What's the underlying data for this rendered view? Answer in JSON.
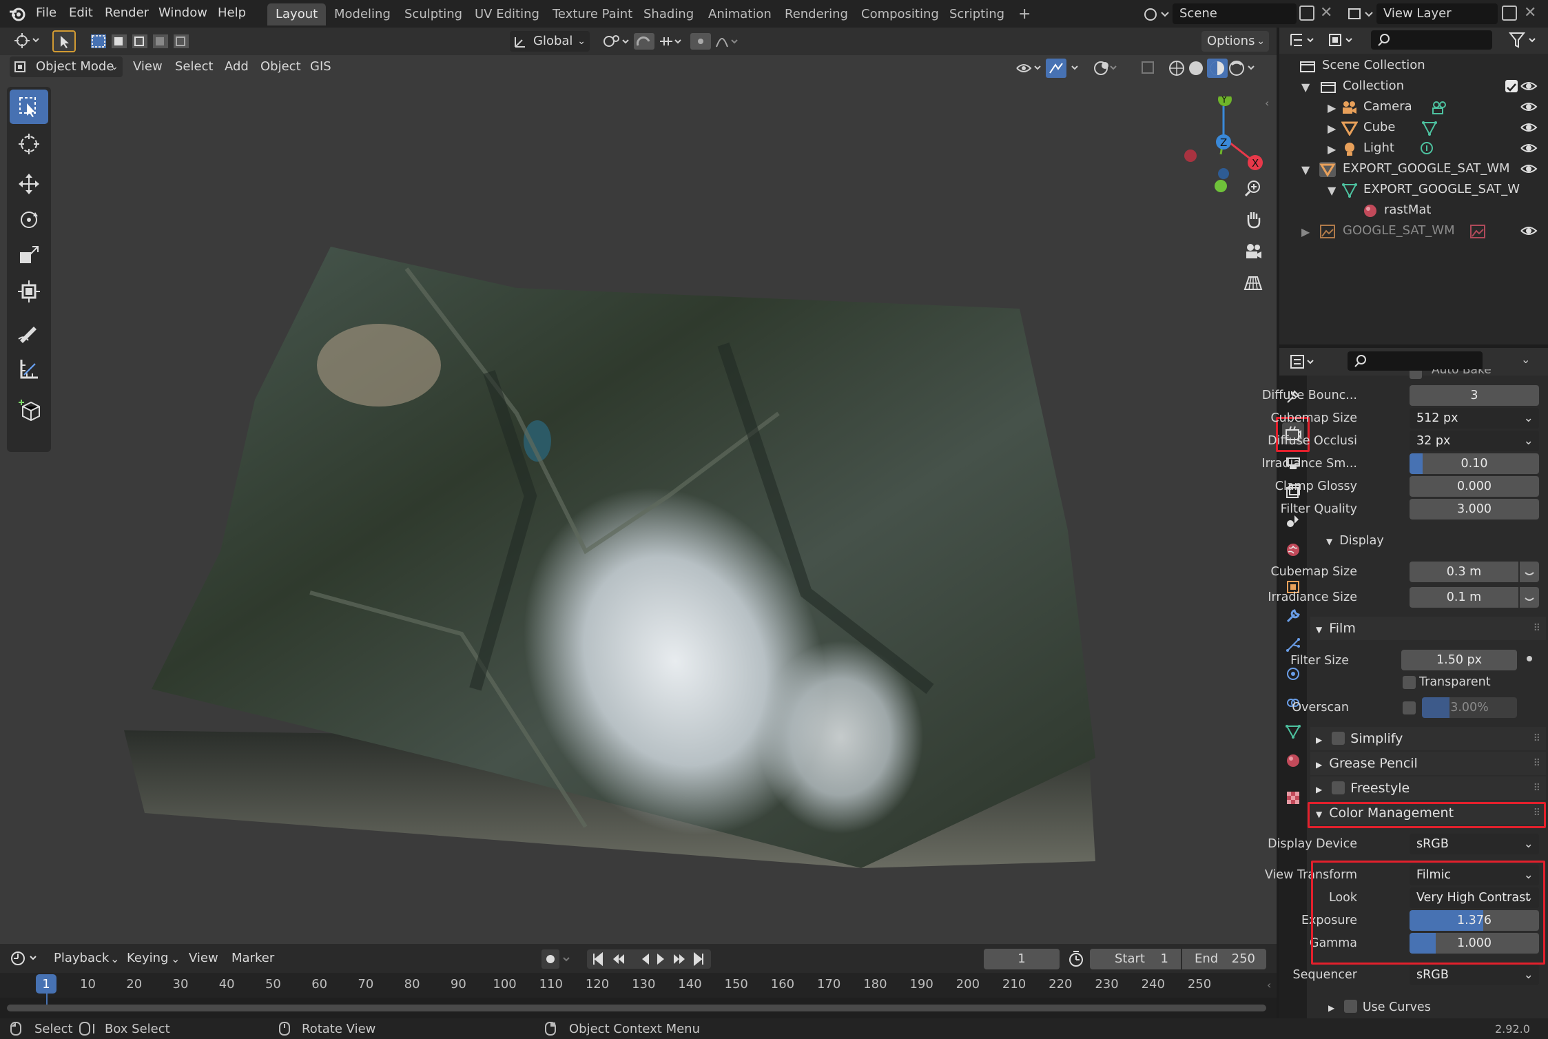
{
  "topbar": {
    "menus": [
      "File",
      "Edit",
      "Render",
      "Window",
      "Help"
    ],
    "workspaces": [
      "Layout",
      "Modeling",
      "Sculpting",
      "UV Editing",
      "Texture Paint",
      "Shading",
      "Animation",
      "Rendering",
      "Compositing",
      "Scripting"
    ],
    "add_workspace": "+",
    "scene_name": "Scene",
    "view_layer_name": "View Layer"
  },
  "viewport": {
    "transform_orientation": "Global",
    "options_label": "Options",
    "mode": "Object Mode",
    "menus": [
      "View",
      "Select",
      "Add",
      "Object",
      "GIS"
    ],
    "gizmo_axes": {
      "x": "X",
      "y": "Y",
      "z": "Z"
    }
  },
  "timeline": {
    "menus": [
      "Playback",
      "Keying",
      "View",
      "Marker"
    ],
    "current_frame": "1",
    "start_label": "Start",
    "start_value": "1",
    "end_label": "End",
    "end_value": "250",
    "ticks": [
      "1",
      "10",
      "20",
      "30",
      "40",
      "50",
      "60",
      "70",
      "80",
      "90",
      "100",
      "110",
      "120",
      "130",
      "140",
      "150",
      "160",
      "170",
      "180",
      "190",
      "200",
      "210",
      "220",
      "230",
      "240",
      "250"
    ]
  },
  "statusbar": {
    "select": "Select",
    "box_select": "Box Select",
    "rotate_view": "Rotate View",
    "context_menu": "Object Context Menu",
    "version": "2.92.0"
  },
  "outliner": {
    "scene_collection": "Scene Collection",
    "collection": "Collection",
    "camera": "Camera",
    "cube": "Cube",
    "light": "Light",
    "export_obj": "EXPORT_GOOGLE_SAT_WM",
    "export_mesh": "EXPORT_GOOGLE_SAT_W",
    "material": "rastMat",
    "image_obj": "GOOGLE_SAT_WM"
  },
  "properties": {
    "auto_bake": "Auto Bake",
    "diffuse_bounces": {
      "label": "Diffuse Bounc...",
      "value": "3"
    },
    "cubemap_size": {
      "label": "Cubemap Size",
      "value": "512 px"
    },
    "diffuse_occlusion": {
      "label": "Diffuse Occlusi",
      "value": "32 px"
    },
    "irradiance_smoothing": {
      "label": "Irradiance Sm...",
      "value": "0.10",
      "fraction": 0.1
    },
    "clamp_glossy": {
      "label": "Clamp Glossy",
      "value": "0.000"
    },
    "filter_quality": {
      "label": "Filter Quality",
      "value": "3.000"
    },
    "display_section": "Display",
    "display_cubemap_size": {
      "label": "Cubemap Size",
      "value": "0.3 m"
    },
    "display_irradiance_size": {
      "label": "Irradiance Size",
      "value": "0.1 m"
    },
    "film_section": "Film",
    "filter_size": {
      "label": "Filter Size",
      "value": "1.50 px"
    },
    "transparent": "Transparent",
    "overscan": {
      "label": "Overscan",
      "value": "3.00%"
    },
    "simplify": "Simplify",
    "grease_pencil": "Grease Pencil",
    "freestyle": "Freestyle",
    "color_management": "Color Management",
    "display_device": {
      "label": "Display Device",
      "value": "sRGB"
    },
    "view_transform": {
      "label": "View Transform",
      "value": "Filmic"
    },
    "look": {
      "label": "Look",
      "value": "Very High Contrast"
    },
    "exposure": {
      "label": "Exposure",
      "value": "1.376",
      "fraction": 0.57
    },
    "gamma": {
      "label": "Gamma",
      "value": "1.000",
      "fraction": 0.2
    },
    "sequencer": {
      "label": "Sequencer",
      "value": "sRGB"
    },
    "use_curves": "Use Curves"
  },
  "colors": {
    "accent": "#4772b3",
    "highlight": "#e3202c",
    "axis_x": "#e8394a",
    "axis_y": "#6fb52a",
    "axis_z": "#3a89d8"
  }
}
